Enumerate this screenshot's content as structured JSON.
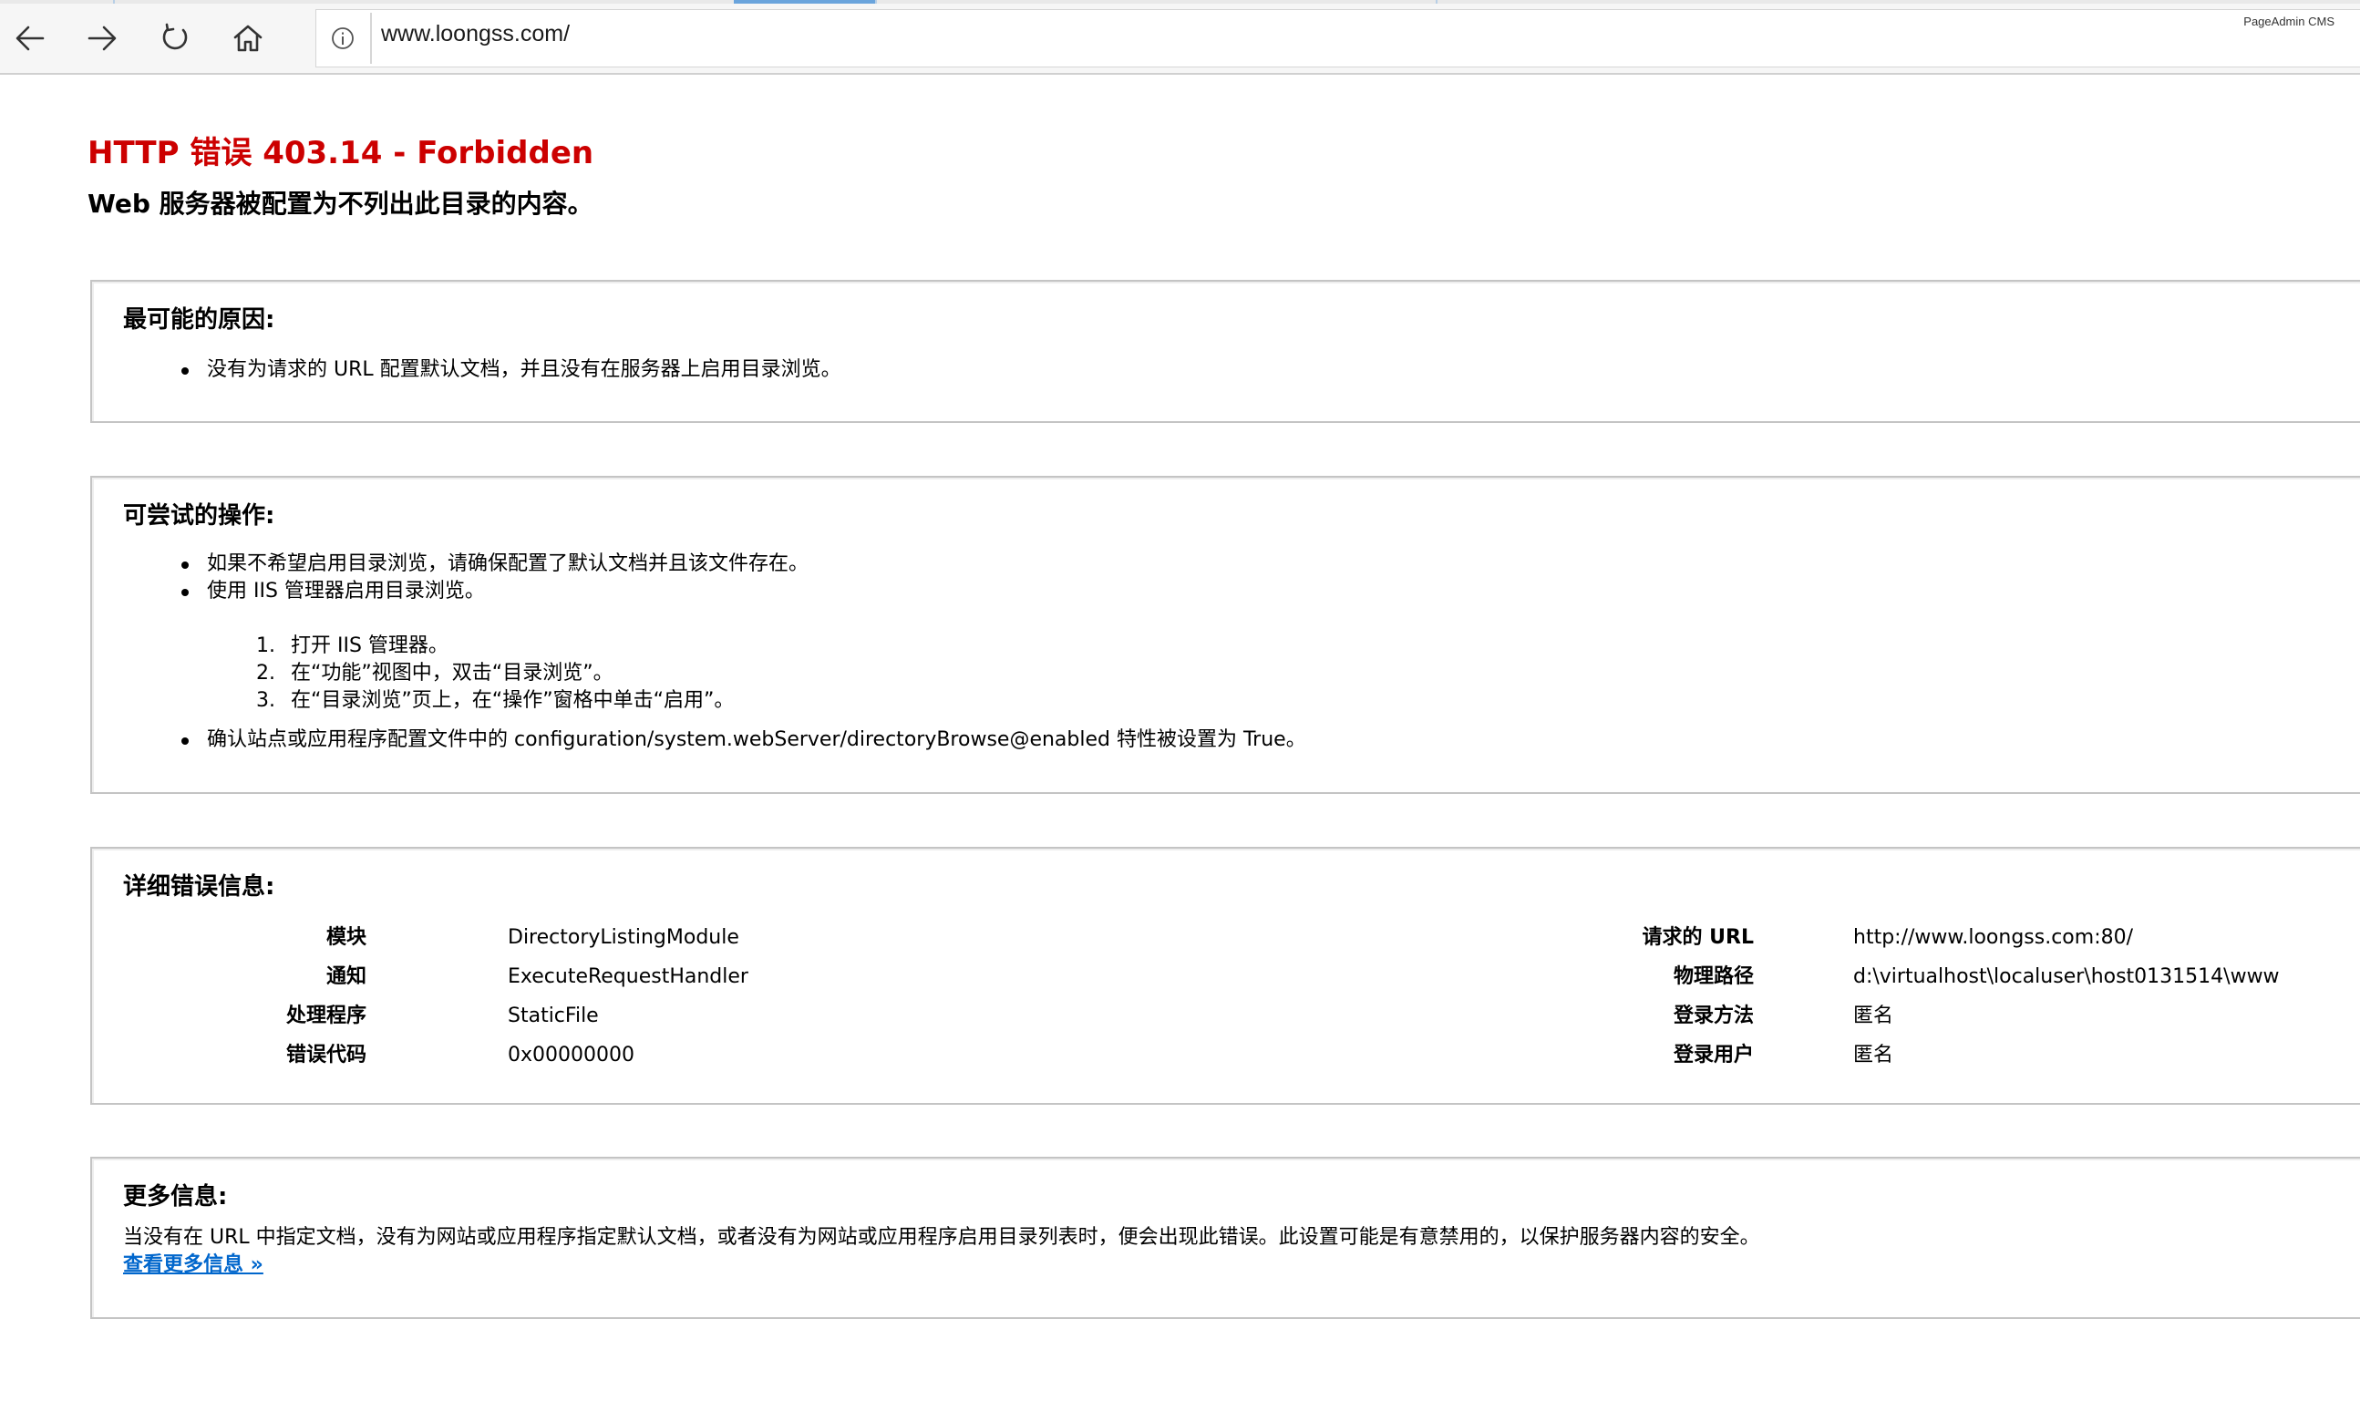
{
  "browser": {
    "url": "www.loongss.com/",
    "extension_label": "PageAdmin CMS",
    "icons": {
      "back": "arrow-left-icon",
      "forward": "arrow-right-icon",
      "refresh": "refresh-icon",
      "home": "home-icon",
      "site_info": "info-icon"
    }
  },
  "page": {
    "title": "HTTP 错误 403.14 - Forbidden",
    "subtitle": "Web 服务器被配置为不列出此目录的内容。",
    "title_color": "#cc0000",
    "link_color": "#0066cc"
  },
  "causes": {
    "heading": "最可能的原因:",
    "items": [
      "没有为请求的 URL 配置默认文档，并且没有在服务器上启用目录浏览。"
    ]
  },
  "actions": {
    "heading": "可尝试的操作:",
    "items": [
      "如果不希望启用目录浏览，请确保配置了默认文档并且该文件存在。",
      "使用 IIS 管理器启用目录浏览。"
    ],
    "steps": [
      {
        "num": "1.",
        "text": "打开 IIS 管理器。"
      },
      {
        "num": "2.",
        "text": "在“功能”视图中，双击“目录浏览”。"
      },
      {
        "num": "3.",
        "text": "在“目录浏览”页上，在“操作”窗格中单击“启用”。"
      }
    ],
    "final_item": "确认站点或应用程序配置文件中的 configuration/system.webServer/directoryBrowse@enabled 特性被设置为 True。"
  },
  "details": {
    "heading": "详细错误信息:",
    "left": [
      {
        "label": "模块",
        "value": "DirectoryListingModule"
      },
      {
        "label": "通知",
        "value": "ExecuteRequestHandler"
      },
      {
        "label": "处理程序",
        "value": "StaticFile"
      },
      {
        "label": "错误代码",
        "value": "0x00000000"
      }
    ],
    "right": [
      {
        "label": "请求的 URL",
        "value": "http://www.loongss.com:80/"
      },
      {
        "label": "物理路径",
        "value": "d:\\virtualhost\\localuser\\host0131514\\www"
      },
      {
        "label": "登录方法",
        "value": "匿名"
      },
      {
        "label": "登录用户",
        "value": "匿名"
      }
    ]
  },
  "more_info": {
    "heading": "更多信息:",
    "text": "当没有在 URL 中指定文档，没有为网站或应用程序指定默认文档，或者没有为网站或应用程序启用目录列表时，便会出现此错误。此设置可能是有意禁用的，以保护服务器内容的安全。",
    "link_label": "查看更多信息 »"
  }
}
